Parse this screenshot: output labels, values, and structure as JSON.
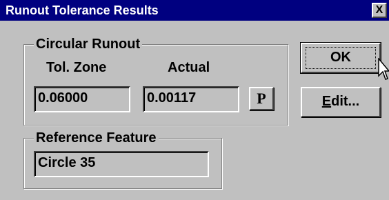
{
  "window": {
    "title": "Runout Tolerance Results",
    "close_glyph": "X"
  },
  "circular_runout": {
    "group_label": "Circular Runout",
    "tol_zone_label": "Tol. Zone",
    "actual_label": "Actual",
    "tol_zone_value": "0.06000",
    "actual_value": "0.00117",
    "p_button_label": "P"
  },
  "reference_feature": {
    "group_label": "Reference Feature",
    "value": "Circle 35"
  },
  "buttons": {
    "ok_label": "OK",
    "edit_label_prefix": "",
    "edit_label_mnemonic": "E",
    "edit_label_rest": "dit..."
  },
  "icons": {
    "cursor": "arrow-pointer-icon"
  },
  "colors": {
    "dialog_bg": "#c0c0c0",
    "titlebar_bg": "#000080",
    "titlebar_text": "#ffffff"
  }
}
